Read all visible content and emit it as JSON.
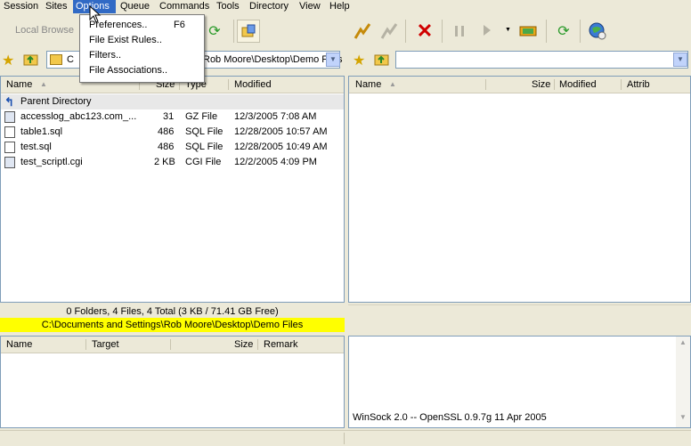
{
  "menu": [
    "Session",
    "Sites",
    "Options",
    "Queue",
    "Commands",
    "Tools",
    "Directory",
    "View",
    "Help"
  ],
  "options_menu": {
    "items": [
      {
        "label": "Preferences..",
        "shortcut": "F6"
      },
      {
        "label": "File Exist Rules..",
        "shortcut": ""
      },
      {
        "label": "Filters..",
        "shortcut": ""
      },
      {
        "label": "File Associations..",
        "shortcut": ""
      }
    ]
  },
  "local_toolbar": {
    "browse_label": "Local Browse"
  },
  "local_path": {
    "prefix": "C",
    "visible_text": "Rob Moore\\Desktop\\Demo Files"
  },
  "remote_path": {
    "value": ""
  },
  "local_list": {
    "headers": {
      "name": "Name",
      "size": "Size",
      "type": "Type",
      "modified": "Modified"
    },
    "parent": "Parent Directory",
    "files": [
      {
        "name": "accesslog_abc123.com_...",
        "size": "31",
        "type": "GZ File",
        "modified": "12/3/2005 7:08 AM"
      },
      {
        "name": "table1.sql",
        "size": "486",
        "type": "SQL File",
        "modified": "12/28/2005 10:57 AM"
      },
      {
        "name": "test.sql",
        "size": "486",
        "type": "SQL File",
        "modified": "12/28/2005 10:49 AM"
      },
      {
        "name": "test_scriptl.cgi",
        "size": "2 KB",
        "type": "CGI File",
        "modified": "12/2/2005 4:09 PM"
      }
    ]
  },
  "remote_list": {
    "headers": {
      "name": "Name",
      "size": "Size",
      "modified": "Modified",
      "attrib": "Attrib"
    }
  },
  "local_status": {
    "summary": "0 Folders, 4 Files, 4 Total (3 KB / 71.41 GB Free)",
    "path": "C:\\Documents and Settings\\Rob Moore\\Desktop\\Demo Files",
    "path_bg": "#ffff00"
  },
  "queue": {
    "headers": {
      "name": "Name",
      "target": "Target",
      "size": "Size",
      "remark": "Remark"
    }
  },
  "log": {
    "line": "WinSock 2.0 -- OpenSSL 0.9.7g 11 Apr 2005"
  }
}
